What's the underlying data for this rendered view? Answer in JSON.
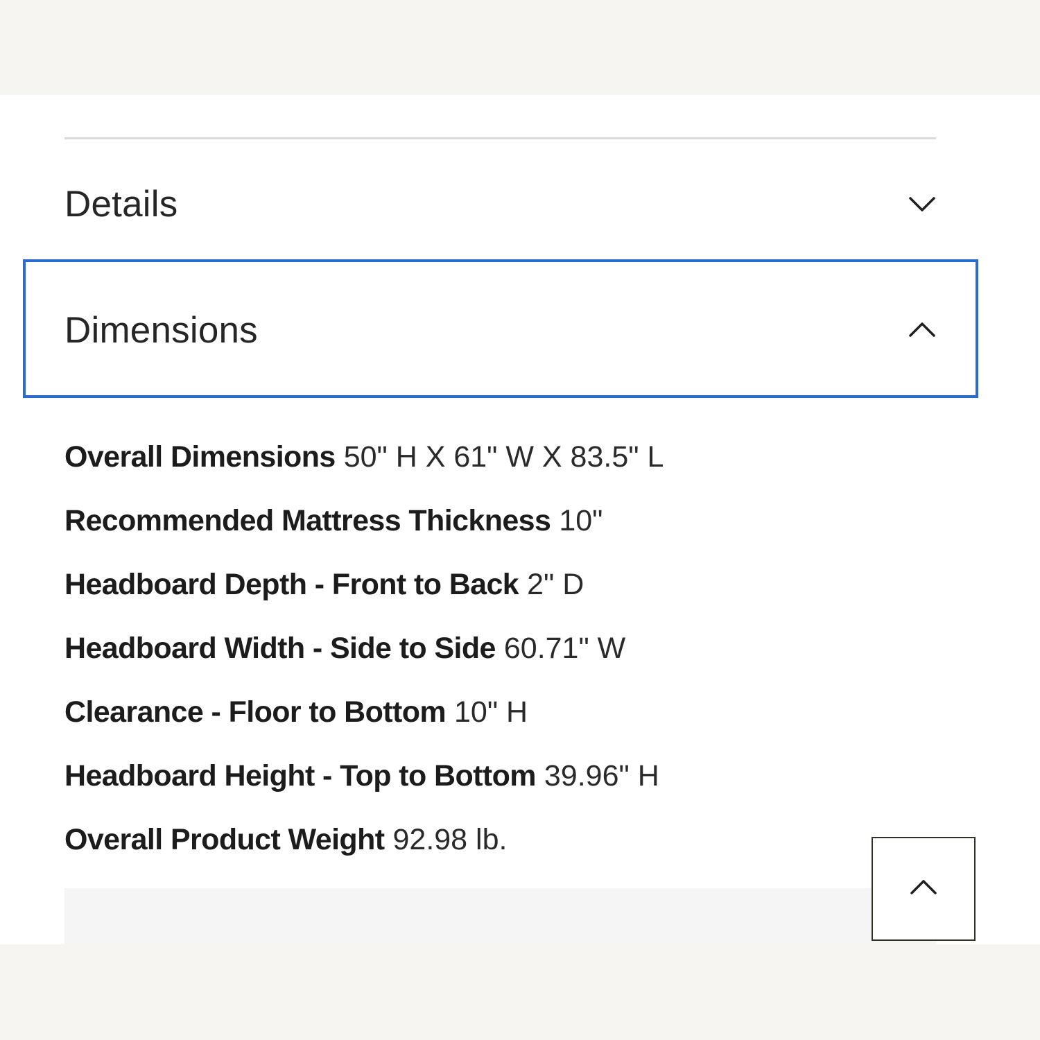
{
  "accordion": {
    "details": {
      "title": "Details",
      "state": "collapsed",
      "icon": "chevron-down-icon"
    },
    "dimensions": {
      "title": "Dimensions",
      "state": "expanded",
      "icon": "chevron-up-icon",
      "focus_color": "#2a6bd1",
      "items": [
        {
          "label": "Overall Dimensions",
          "value": "50\" H X 61\" W X 83.5\" L"
        },
        {
          "label": "Recommended Mattress Thickness",
          "value": "10\""
        },
        {
          "label": "Headboard Depth - Front to Back",
          "value": "2\" D"
        },
        {
          "label": "Headboard Width - Side to Side",
          "value": "60.71\" W"
        },
        {
          "label": "Clearance - Floor to Bottom",
          "value": "10\" H"
        },
        {
          "label": "Headboard Height - Top to Bottom",
          "value": "39.96\" H"
        },
        {
          "label": "Overall Product Weight",
          "value": "92.98 lb."
        }
      ]
    }
  },
  "back_to_top": {
    "icon": "chevron-up-icon",
    "border_color": "#2f3323"
  }
}
